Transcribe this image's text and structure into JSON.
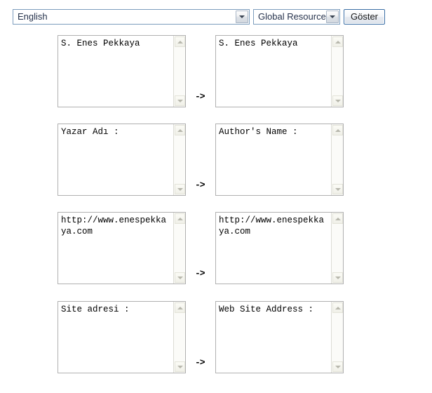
{
  "toolbar": {
    "language_select": {
      "value": "English",
      "icon": "chevron-down-icon"
    },
    "scope_select": {
      "value": "Global Resources",
      "icon": "chevron-down-icon"
    },
    "submit_button": {
      "label": "Göster"
    }
  },
  "arrow_label": "->",
  "scroll": {
    "up_icon": "chevron-up-icon",
    "down_icon": "chevron-down-icon"
  },
  "rows": [
    {
      "source": "S. Enes Pekkaya",
      "target": "S. Enes Pekkaya"
    },
    {
      "source": "Yazar Adı :",
      "target": "Author's Name :"
    },
    {
      "source": "http://www.enespekkaya.com",
      "target": "http://www.enespekkaya.com"
    },
    {
      "source": "Site adresi :",
      "target": "Web Site Address :"
    }
  ],
  "colors": {
    "select_border": "#7c9dbd",
    "button_border": "#3a6ea5",
    "textarea_border": "#b0b0b0",
    "scrollbar_face": "#f0f0e8",
    "text": "#000000"
  }
}
